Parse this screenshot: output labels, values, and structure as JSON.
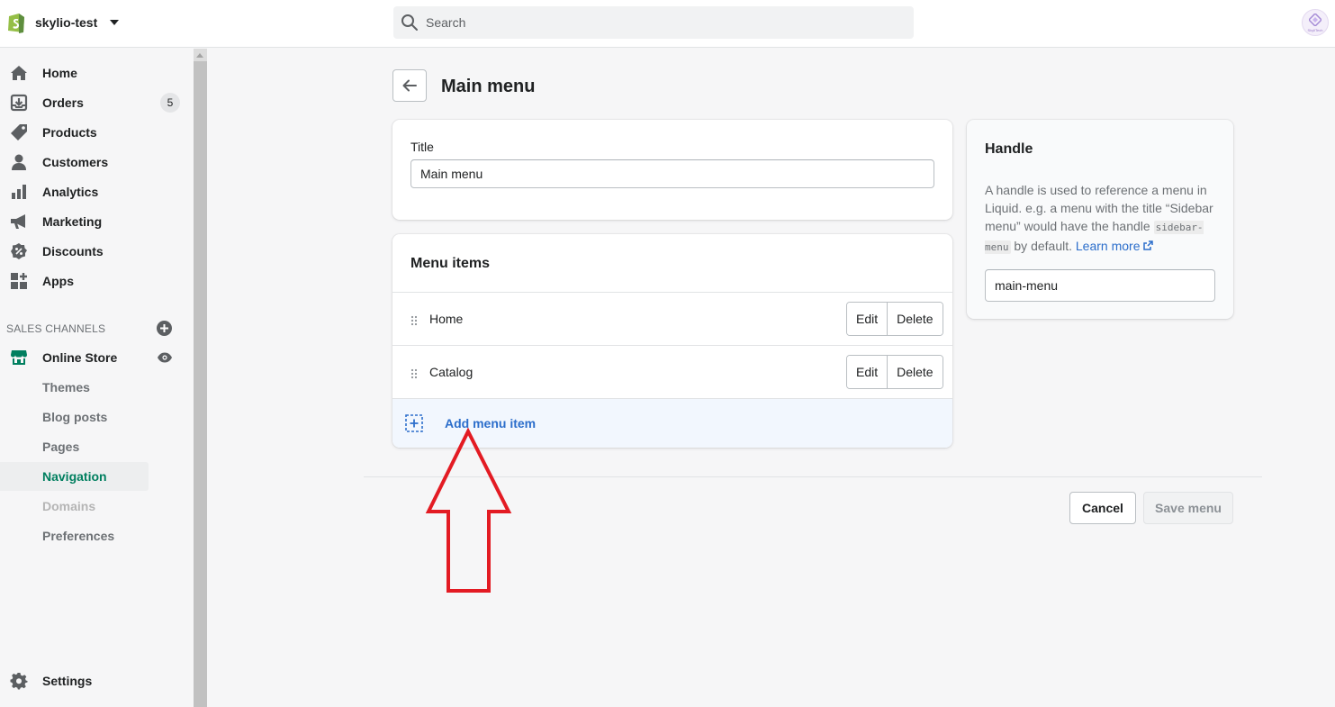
{
  "topbar": {
    "store_name": "skylio-test",
    "search_placeholder": "Search",
    "avatar_text": "SkyliTech"
  },
  "sidebar": {
    "items": [
      {
        "label": "Home",
        "icon": "home-icon"
      },
      {
        "label": "Orders",
        "icon": "orders-icon",
        "badge": "5"
      },
      {
        "label": "Products",
        "icon": "tag-icon"
      },
      {
        "label": "Customers",
        "icon": "person-icon"
      },
      {
        "label": "Analytics",
        "icon": "bar-chart-icon"
      },
      {
        "label": "Marketing",
        "icon": "megaphone-icon"
      },
      {
        "label": "Discounts",
        "icon": "discount-icon"
      },
      {
        "label": "Apps",
        "icon": "apps-icon"
      }
    ],
    "section_title": "SALES CHANNELS",
    "online_store": "Online Store",
    "subitems": [
      {
        "label": "Themes"
      },
      {
        "label": "Blog posts"
      },
      {
        "label": "Pages"
      },
      {
        "label": "Navigation",
        "state": "active"
      },
      {
        "label": "Domains",
        "state": "disabled"
      },
      {
        "label": "Preferences"
      }
    ],
    "settings": "Settings"
  },
  "page": {
    "title": "Main menu"
  },
  "title_card": {
    "label": "Title",
    "value": "Main menu"
  },
  "menu_card": {
    "heading": "Menu items",
    "rows": [
      {
        "label": "Home",
        "edit": "Edit",
        "delete": "Delete"
      },
      {
        "label": "Catalog",
        "edit": "Edit",
        "delete": "Delete"
      }
    ],
    "add_label": "Add menu item"
  },
  "handle_card": {
    "title": "Handle",
    "desc_1": "A handle is used to reference a menu in Liquid. e.g. a menu with the title “Sidebar menu” would have the handle ",
    "desc_code": "sidebar-menu",
    "desc_2": " by default. ",
    "learn_more": "Learn more",
    "value": "main-menu"
  },
  "footer": {
    "cancel": "Cancel",
    "save": "Save menu"
  },
  "colors": {
    "accent_green": "#007f5f",
    "link_blue": "#2c6ecb",
    "annotation_red": "#e31b23"
  }
}
